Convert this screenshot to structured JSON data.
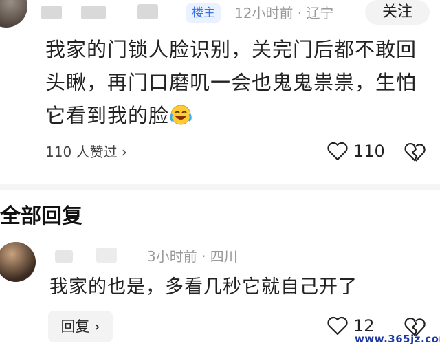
{
  "post": {
    "op_badge": "楼主",
    "meta": "12小时前 · 辽宁",
    "follow_label": "关注",
    "text": "我家的门锁人脸识别，关完门后都不敢回头瞅，再门口磨叽一会也鬼鬼祟祟，生怕它看到我的脸",
    "emoji_icon": "laughing-crying-emoji",
    "likes_summary": "110 人赞过 ›",
    "like_count": "110"
  },
  "replies_section": {
    "title": "全部回复"
  },
  "reply": {
    "meta": "3小时前 · 四川",
    "text": "我家的也是，多看几秒它就自己开了",
    "reply_label": "回复 ›",
    "like_count": "12"
  },
  "watermark": "www.365jz.com",
  "colors": {
    "accent": "#3b72e3",
    "muted": "#9a9a9a"
  }
}
